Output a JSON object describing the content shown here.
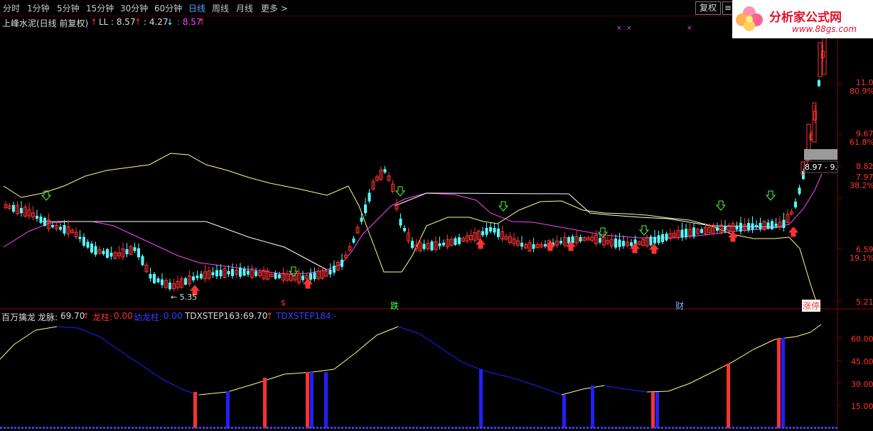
{
  "toolbar": {
    "periods": [
      "分时",
      "1分钟",
      "5分钟",
      "15分钟",
      "30分钟",
      "60分钟",
      "日线",
      "周线",
      "月线",
      "更多 >"
    ],
    "active": "日线",
    "fq_button": "复权",
    "small_button": "≡"
  },
  "logo": {
    "brand": "分析家公式网",
    "url": "www.88gs.com"
  },
  "main_panel": {
    "title": "上峰水泥(日线 前复权)",
    "ll_label": "LL",
    "ll_value": ": 8.57",
    "v2": ": 4.27",
    "v3": ": 8.57",
    "low_annotation": "← 5.35",
    "price_box": "8.97 - 9.",
    "markers": [
      "$",
      "跌",
      "财",
      "涨停"
    ],
    "y_labels": [
      {
        "price": "11.05",
        "pct": "80.9%"
      },
      {
        "price": "9.67",
        "pct": "61.8%"
      },
      {
        "price": "8.82",
        "pct": ""
      },
      {
        "price": "7.97",
        "pct": "38.2%"
      },
      {
        "price": "6.59",
        "pct": "19.1%"
      },
      {
        "price": "5.21",
        "pct": ""
      }
    ]
  },
  "sub_panel": {
    "title": "百万擒龙",
    "longmai_label": "龙脉:",
    "longmai_value": "69.70",
    "longzhu_label": "龙柱:",
    "longzhu_value": "0.00",
    "qilongzhu_label": "幼龙柱:",
    "qilongzhu_value": "0.00",
    "step163_label": "TDXSTEP163:",
    "step163_value": "69.70",
    "step184_label": "TDXSTEP184:",
    "step184_value": "-",
    "y_labels": [
      "60.00",
      "45.00",
      "30.00",
      "15.00"
    ]
  },
  "colors": {
    "up": "#ff3232",
    "down": "#54ffff",
    "yellow": "#ffff80",
    "magenta": "#ff44ff",
    "white": "#ffffff",
    "blue": "#2020ff",
    "gridred": "#8b0000",
    "green": "#44ff44"
  }
}
